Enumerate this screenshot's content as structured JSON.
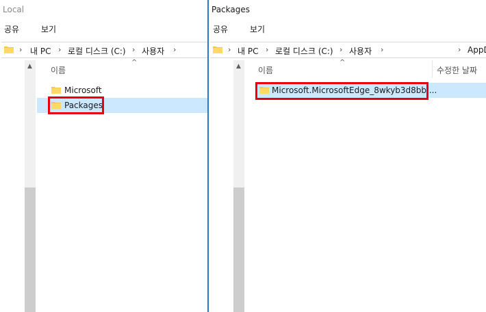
{
  "left": {
    "title": "Local",
    "ribbon": {
      "share": "공유",
      "view": "보기"
    },
    "breadcrumb": [
      "내 PC",
      "로컬 디스크 (C:)",
      "사용자"
    ],
    "column_name": "이름",
    "items": [
      {
        "name": "Microsoft",
        "selected": false
      },
      {
        "name": "Packages",
        "selected": true
      }
    ]
  },
  "right": {
    "title": "Packages",
    "ribbon": {
      "share": "공유",
      "view": "보기"
    },
    "breadcrumb": [
      "내 PC",
      "로컬 디스크 (C:)",
      "사용자",
      "AppD"
    ],
    "column_name": "이름",
    "column_modified": "수정한 날짜",
    "items": [
      {
        "name": "Microsoft.MicrosoftEdge_8wkyb3d8bb ...",
        "selected": true
      }
    ]
  },
  "colors": {
    "highlight": "#e60012",
    "selection": "#cce8ff",
    "divider": "#2b78c9"
  }
}
